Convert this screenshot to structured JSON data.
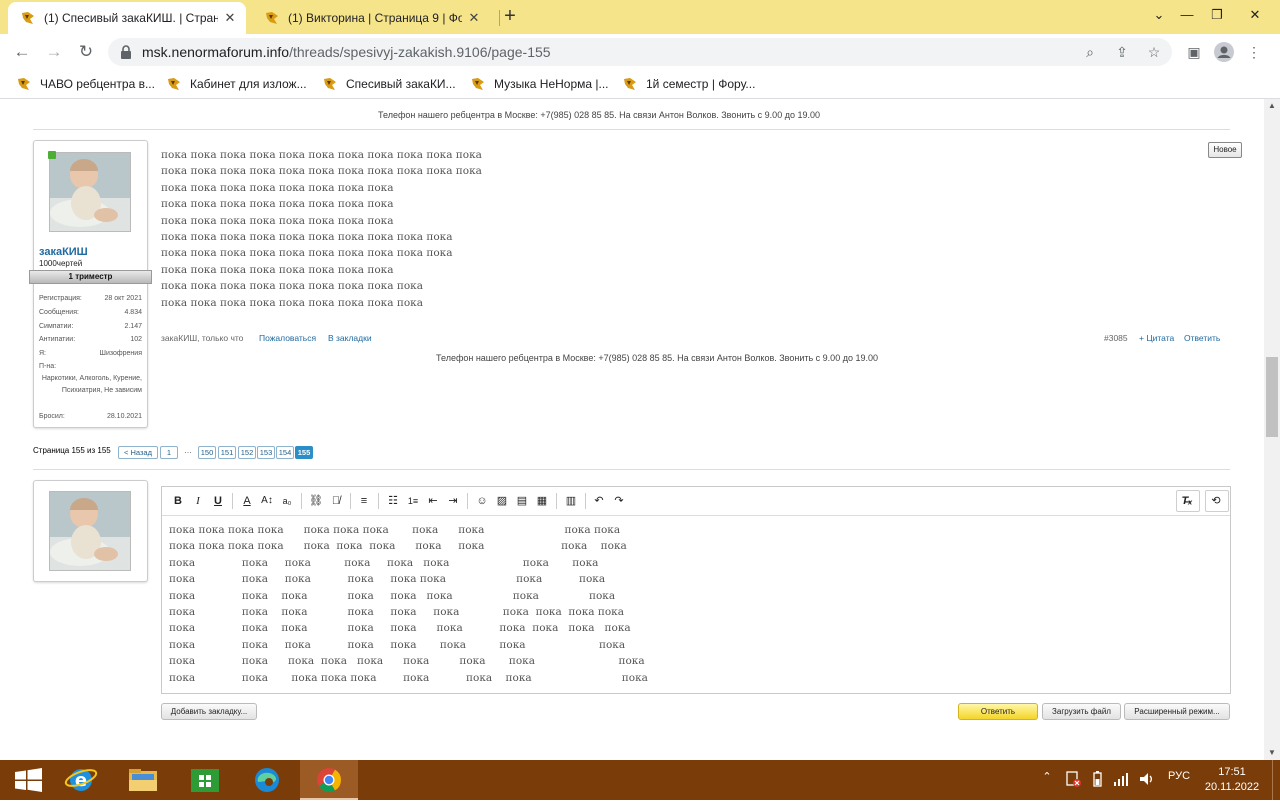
{
  "browser": {
    "tabs": [
      {
        "title": "(1) Спесивый закаКИШ. | Страни",
        "active": true
      },
      {
        "title": "(1) Викторина | Страница 9 | Фо",
        "active": false
      }
    ],
    "url_host": "msk.nenormaforum.info",
    "url_path": "/threads/spesivyj-zakakish.9106/page-155",
    "bookmarks": [
      "ЧАВО ребцентра в...",
      "Кабинет для излож...",
      "Спесивый закаКИ...",
      "Музыка НеНорма |...",
      "1й семестр | Фору..."
    ]
  },
  "page": {
    "phone_banner": "Телефон нашего ребцентра в Москве: +7(985) 028 85 85. На связи Антон Волков. Звонить с 9.00 до 19.00",
    "post": {
      "username": "закаКИШ",
      "user_title": "1000чертей",
      "rank": "1 триместр",
      "stats": [
        {
          "key": "Регистрация:",
          "value": "28 окт 2021"
        },
        {
          "key": "Сообщения:",
          "value": "4.834"
        },
        {
          "key": "Симпатии:",
          "value": "2.147"
        },
        {
          "key": "Антипатии:",
          "value": "102"
        },
        {
          "key": "Я:",
          "value": "Шизофрения"
        }
      ],
      "pna_label": "П-на:",
      "pna_value": "Наркотики, Алкоголь, Курение, Психиатрия, Не зависим",
      "quit_label": "Бросил:",
      "quit_value": "28.10.2021",
      "new_badge": "Новое",
      "message_lines": [
        "пока пока пока пока пока пока пока пока пока пока пока",
        "пока пока пока пока пока пока пока пока пока пока пока",
        "пока пока пока пока пока пока пока пока",
        "пока пока пока пока пока пока пока пока",
        "пока пока пока пока пока пока пока пока",
        "пока пока пока пока пока пока пока пока пока пока",
        "пока пока пока пока пока пока пока пока пока пока",
        "пока пока пока пока пока пока пока пока",
        "пока пока пока пока пока пока пока пока пока",
        "пока пока пока пока пока пока пока пока пока"
      ],
      "author_meta": "закаКИШ, только что",
      "report_link": "Пожаловаться",
      "bookmark_link": "В закладки",
      "post_number": "#3085",
      "quote_link": "+ Цитата",
      "reply_link": "Ответить"
    },
    "pagination": {
      "label": "Страница 155 из 155",
      "back": "< Назад",
      "first": "1",
      "ellipsis": "…",
      "pages": [
        "150",
        "151",
        "152",
        "153",
        "154"
      ],
      "current": "155"
    },
    "editor": {
      "lines": [
        "пока пока пока пока      пока пока пока       пока      пока                        пока пока",
        "пока пока пока пока      пока  пока  пока      пока     пока                       пока    пока",
        "пока              пока     пока          пока     пока   пока                      пока       пока",
        "пока              пока     пока           пока     пока пока                     пока           пока",
        "пока              пока    пока            пока     пока   пока                  пока               пока",
        "пока              пока    пока            пока     пока     пока             пока  пока  пока пока",
        "пока              пока    пока            пока     пока      пока           пока  пока   пока   пока",
        "пока              пока     пока           пока     пока       пока          пока                      пока",
        "пока              пока      пока  пока   пока      пока         пока       пока                         пока",
        "пока              пока       пока пока пока        пока           пока    пока                           пока"
      ],
      "add_bookmark_btn": "Добавить закладку...",
      "reply_btn": "Ответить",
      "upload_btn": "Загрузить файл",
      "advanced_btn": "Расширенный режим..."
    }
  },
  "taskbar": {
    "lang": "РУС",
    "time": "17:51",
    "date": "20.11.2022"
  },
  "colors": {
    "tabstrip": "#f6e48a",
    "link": "#1f6aa0",
    "taskbar": "#7a3d09",
    "current_page": "#2b8ec7",
    "primary_button": "#f4d52a"
  }
}
